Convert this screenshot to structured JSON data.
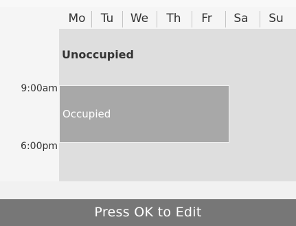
{
  "schedule": {
    "days": [
      "Mo",
      "Tu",
      "We",
      "Th",
      "Fr",
      "Sa",
      "Su"
    ],
    "unoccupied_label": "Unoccupied",
    "occupied_label": "Occupied",
    "time_start": "9:00am",
    "time_end": "6:00pm",
    "occupied_days": [
      "Mo",
      "Tu",
      "We",
      "Th",
      "Fr"
    ]
  },
  "footer": {
    "label": "Press OK to Edit"
  },
  "colors": {
    "grid": "#dedede",
    "occupied": "#a8a8a8",
    "footer": "#777777"
  }
}
